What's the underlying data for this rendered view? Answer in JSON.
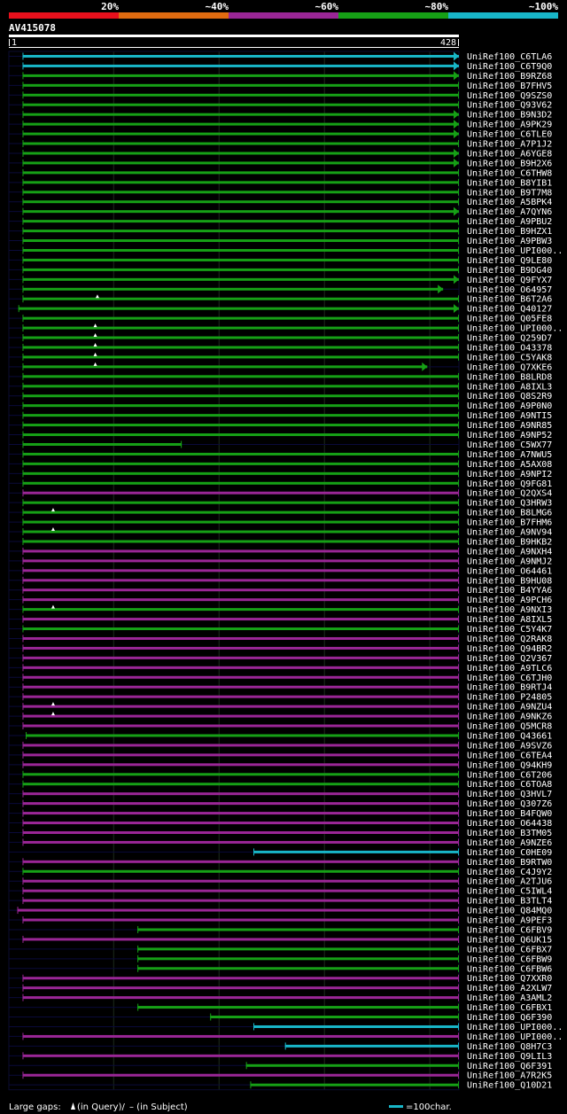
{
  "chart_data": {
    "type": "alignment-graphic",
    "query_name": "AV415078",
    "axis": {
      "min": 1,
      "max": 428,
      "min_label": "1",
      "max_label": "428"
    },
    "identity_bins": [
      {
        "label": "20%",
        "color": "#e8101c"
      },
      {
        "label": "~40%",
        "color": "#e06b10"
      },
      {
        "label": "~60%",
        "color": "#9a2696"
      },
      {
        "label": "~80%",
        "color": "#16a016"
      },
      {
        "label": "~100%",
        "color": "#18b6c8"
      }
    ],
    "footer": {
      "gaps_text": "Large gaps:",
      "query_legend": "(in Query)/",
      "subject_legend": "– (in Subject)",
      "scale_text": "=100char.",
      "scale_chars": 100
    },
    "hits": [
      {
        "name": "UniRef100_C6TLA6",
        "start": 14,
        "end": 428,
        "id": 100,
        "arrow": true
      },
      {
        "name": "UniRef100_C6T9Q0",
        "start": 14,
        "end": 428,
        "id": 100,
        "arrow": true
      },
      {
        "name": "UniRef100_B9RZ68",
        "start": 14,
        "end": 428,
        "id": 80,
        "arrow": true
      },
      {
        "name": "UniRef100_B7FHV5",
        "start": 14,
        "end": 428,
        "id": 80
      },
      {
        "name": "UniRef100_Q9SZS0",
        "start": 14,
        "end": 428,
        "id": 80
      },
      {
        "name": "UniRef100_Q93V62",
        "start": 14,
        "end": 428,
        "id": 80
      },
      {
        "name": "UniRef100_B9N3D2",
        "start": 14,
        "end": 428,
        "id": 80,
        "arrow": true
      },
      {
        "name": "UniRef100_A9PK29",
        "start": 14,
        "end": 428,
        "id": 80,
        "arrow": true
      },
      {
        "name": "UniRef100_C6TLE0",
        "start": 14,
        "end": 428,
        "id": 80,
        "arrow": true
      },
      {
        "name": "UniRef100_A7P1J2",
        "start": 14,
        "end": 428,
        "id": 80
      },
      {
        "name": "UniRef100_A6YGE8",
        "start": 14,
        "end": 428,
        "id": 80,
        "arrow": true
      },
      {
        "name": "UniRef100_B9H2X6",
        "start": 14,
        "end": 428,
        "id": 80,
        "arrow": true
      },
      {
        "name": "UniRef100_C6THW8",
        "start": 14,
        "end": 428,
        "id": 80
      },
      {
        "name": "UniRef100_B8YIB1",
        "start": 14,
        "end": 428,
        "id": 80
      },
      {
        "name": "UniRef100_B9T7M8",
        "start": 14,
        "end": 428,
        "id": 80
      },
      {
        "name": "UniRef100_A5BPK4",
        "start": 14,
        "end": 428,
        "id": 80
      },
      {
        "name": "UniRef100_A7QYN6",
        "start": 14,
        "end": 428,
        "id": 80,
        "arrow": true
      },
      {
        "name": "UniRef100_A9PBU2",
        "start": 14,
        "end": 428,
        "id": 80
      },
      {
        "name": "UniRef100_B9HZX1",
        "start": 14,
        "end": 428,
        "id": 80
      },
      {
        "name": "UniRef100_A9PBW3",
        "start": 14,
        "end": 428,
        "id": 80
      },
      {
        "name": "UniRef100_UPI000..",
        "start": 14,
        "end": 428,
        "id": 80
      },
      {
        "name": "UniRef100_Q9LE80",
        "start": 14,
        "end": 428,
        "id": 80
      },
      {
        "name": "UniRef100_B9DG40",
        "start": 14,
        "end": 428,
        "id": 80
      },
      {
        "name": "UniRef100_Q9FYX7",
        "start": 14,
        "end": 428,
        "id": 80,
        "arrow": true
      },
      {
        "name": "UniRef100_O64957",
        "start": 14,
        "end": 413,
        "id": 80,
        "arrow": true
      },
      {
        "name": "UniRef100_B6T2A6",
        "start": 14,
        "end": 428,
        "id": 80,
        "qgap": 85
      },
      {
        "name": "UniRef100_Q40127",
        "start": 10,
        "end": 428,
        "id": 80,
        "arrow": true
      },
      {
        "name": "UniRef100_Q05FE8",
        "start": 14,
        "end": 428,
        "id": 80
      },
      {
        "name": "UniRef100_UPI000..",
        "start": 14,
        "end": 428,
        "id": 80,
        "qgap": 83
      },
      {
        "name": "UniRef100_Q259D7",
        "start": 14,
        "end": 428,
        "id": 80,
        "qgap": 83
      },
      {
        "name": "UniRef100_O43378",
        "start": 14,
        "end": 428,
        "id": 80,
        "qgap": 83
      },
      {
        "name": "UniRef100_C5YAK8",
        "start": 14,
        "end": 428,
        "id": 80,
        "qgap": 83
      },
      {
        "name": "UniRef100_Q7XKE6",
        "start": 14,
        "end": 398,
        "id": 80,
        "qgap": 83,
        "arrow": true
      },
      {
        "name": "UniRef100_B8LRD8",
        "start": 14,
        "end": 428,
        "id": 80
      },
      {
        "name": "UniRef100_A8IXL3",
        "start": 14,
        "end": 428,
        "id": 80
      },
      {
        "name": "UniRef100_Q8S2R9",
        "start": 14,
        "end": 428,
        "id": 80
      },
      {
        "name": "UniRef100_A9P0N0",
        "start": 14,
        "end": 428,
        "id": 80
      },
      {
        "name": "UniRef100_A9NTI5",
        "start": 14,
        "end": 428,
        "id": 80
      },
      {
        "name": "UniRef100_A9NR85",
        "start": 14,
        "end": 428,
        "id": 80
      },
      {
        "name": "UniRef100_A9NP52",
        "start": 14,
        "end": 428,
        "id": 80
      },
      {
        "name": "UniRef100_C5WX77",
        "start": 14,
        "end": 165,
        "id": 80
      },
      {
        "name": "UniRef100_A7NWU5",
        "start": 14,
        "end": 428,
        "id": 80
      },
      {
        "name": "UniRef100_A5AX08",
        "start": 14,
        "end": 428,
        "id": 80
      },
      {
        "name": "UniRef100_A9NPI2",
        "start": 14,
        "end": 428,
        "id": 80
      },
      {
        "name": "UniRef100_Q9FG81",
        "start": 14,
        "end": 428,
        "id": 80
      },
      {
        "name": "UniRef100_Q2QXS4",
        "start": 14,
        "end": 428,
        "id": 60
      },
      {
        "name": "UniRef100_Q3HRW3",
        "start": 14,
        "end": 428,
        "id": 80
      },
      {
        "name": "UniRef100_B8LMG6",
        "start": 14,
        "end": 428,
        "id": 80,
        "qgap": 43
      },
      {
        "name": "UniRef100_B7FHM6",
        "start": 14,
        "end": 428,
        "id": 80
      },
      {
        "name": "UniRef100_A9NV94",
        "start": 14,
        "end": 428,
        "id": 80,
        "qgap": 43
      },
      {
        "name": "UniRef100_B9HKB2",
        "start": 14,
        "end": 428,
        "id": 80
      },
      {
        "name": "UniRef100_A9NXH4",
        "start": 14,
        "end": 428,
        "id": 60
      },
      {
        "name": "UniRef100_A9NMJ2",
        "start": 14,
        "end": 428,
        "id": 60
      },
      {
        "name": "UniRef100_O64461",
        "start": 14,
        "end": 428,
        "id": 60
      },
      {
        "name": "UniRef100_B9HU08",
        "start": 14,
        "end": 428,
        "id": 60
      },
      {
        "name": "UniRef100_B4YYA6",
        "start": 14,
        "end": 428,
        "id": 60
      },
      {
        "name": "UniRef100_A9PCH6",
        "start": 14,
        "end": 428,
        "id": 60
      },
      {
        "name": "UniRef100_A9NXI3",
        "start": 14,
        "end": 428,
        "id": 80,
        "qgap": 43
      },
      {
        "name": "UniRef100_A8IXL5",
        "start": 14,
        "end": 428,
        "id": 60
      },
      {
        "name": "UniRef100_C5Y4K7",
        "start": 14,
        "end": 428,
        "id": 80
      },
      {
        "name": "UniRef100_Q2RAK8",
        "start": 14,
        "end": 428,
        "id": 60
      },
      {
        "name": "UniRef100_Q94BR2",
        "start": 14,
        "end": 428,
        "id": 60
      },
      {
        "name": "UniRef100_Q2V367",
        "start": 14,
        "end": 428,
        "id": 60
      },
      {
        "name": "UniRef100_A9TLC6",
        "start": 14,
        "end": 428,
        "id": 60
      },
      {
        "name": "UniRef100_C6TJH0",
        "start": 14,
        "end": 428,
        "id": 60
      },
      {
        "name": "UniRef100_B9RTJ4",
        "start": 14,
        "end": 428,
        "id": 60
      },
      {
        "name": "UniRef100_P24805",
        "start": 14,
        "end": 428,
        "id": 60
      },
      {
        "name": "UniRef100_A9NZU4",
        "start": 14,
        "end": 428,
        "id": 60,
        "qgap": 43
      },
      {
        "name": "UniRef100_A9NKZ6",
        "start": 14,
        "end": 428,
        "id": 60,
        "qgap": 43
      },
      {
        "name": "UniRef100_Q5MCR8",
        "start": 14,
        "end": 428,
        "id": 60
      },
      {
        "name": "UniRef100_Q43661",
        "start": 17,
        "end": 428,
        "id": 80
      },
      {
        "name": "UniRef100_A9SVZ6",
        "start": 14,
        "end": 428,
        "id": 60
      },
      {
        "name": "UniRef100_C6TEA4",
        "start": 14,
        "end": 428,
        "id": 60
      },
      {
        "name": "UniRef100_Q94KH9",
        "start": 14,
        "end": 428,
        "id": 60
      },
      {
        "name": "UniRef100_C6T206",
        "start": 14,
        "end": 428,
        "id": 80
      },
      {
        "name": "UniRef100_C6TOA8",
        "start": 14,
        "end": 428,
        "id": 80
      },
      {
        "name": "UniRef100_Q3HVL7",
        "start": 14,
        "end": 428,
        "id": 60
      },
      {
        "name": "UniRef100_Q307Z6",
        "start": 14,
        "end": 428,
        "id": 60
      },
      {
        "name": "UniRef100_B4FQW0",
        "start": 14,
        "end": 428,
        "id": 60
      },
      {
        "name": "UniRef100_O64438",
        "start": 14,
        "end": 428,
        "id": 60
      },
      {
        "name": "UniRef100_B3TM05",
        "start": 14,
        "end": 428,
        "id": 60
      },
      {
        "name": "UniRef100_A9NZE6",
        "start": 14,
        "end": 428,
        "id": 60
      },
      {
        "name": "UniRef100_C0HE09",
        "start": 233,
        "end": 428,
        "id": 100
      },
      {
        "name": "UniRef100_B9RTW0",
        "start": 14,
        "end": 428,
        "id": 60
      },
      {
        "name": "UniRef100_C4J9Y2",
        "start": 14,
        "end": 428,
        "id": 80
      },
      {
        "name": "UniRef100_A2TJU6",
        "start": 14,
        "end": 428,
        "id": 60
      },
      {
        "name": "UniRef100_C5IWL4",
        "start": 14,
        "end": 428,
        "id": 60
      },
      {
        "name": "UniRef100_B3TLT4",
        "start": 14,
        "end": 428,
        "id": 60
      },
      {
        "name": "UniRef100_Q84MQ0",
        "start": 9,
        "end": 428,
        "id": 60
      },
      {
        "name": "UniRef100_A9PEF3",
        "start": 14,
        "end": 428,
        "id": 60
      },
      {
        "name": "UniRef100_C6FBV9",
        "start": 123,
        "end": 428,
        "id": 80
      },
      {
        "name": "UniRef100_Q6UK15",
        "start": 14,
        "end": 428,
        "id": 60
      },
      {
        "name": "UniRef100_C6FBX7",
        "start": 123,
        "end": 428,
        "id": 80
      },
      {
        "name": "UniRef100_C6FBW9",
        "start": 123,
        "end": 428,
        "id": 80
      },
      {
        "name": "UniRef100_C6FBW6",
        "start": 123,
        "end": 428,
        "id": 80
      },
      {
        "name": "UniRef100_Q7XXR0",
        "start": 14,
        "end": 428,
        "id": 60
      },
      {
        "name": "UniRef100_A2XLW7",
        "start": 14,
        "end": 428,
        "id": 60
      },
      {
        "name": "UniRef100_A3AML2",
        "start": 14,
        "end": 428,
        "id": 60
      },
      {
        "name": "UniRef100_C6FBX1",
        "start": 123,
        "end": 428,
        "id": 80
      },
      {
        "name": "UniRef100_Q6F390",
        "start": 192,
        "end": 428,
        "id": 80
      },
      {
        "name": "UniRef100_UPI000..",
        "start": 233,
        "end": 428,
        "id": 100
      },
      {
        "name": "UniRef100_UPI000..",
        "start": 14,
        "end": 428,
        "id": 60
      },
      {
        "name": "UniRef100_Q8H7C3",
        "start": 263,
        "end": 428,
        "id": 100
      },
      {
        "name": "UniRef100_Q9LIL3",
        "start": 14,
        "end": 428,
        "id": 60
      },
      {
        "name": "UniRef100_Q6F391",
        "start": 226,
        "end": 428,
        "id": 80
      },
      {
        "name": "UniRef100_A7R2K5",
        "start": 14,
        "end": 428,
        "id": 60
      },
      {
        "name": "UniRef100_Q10D21",
        "start": 230,
        "end": 428,
        "id": 80
      }
    ]
  }
}
